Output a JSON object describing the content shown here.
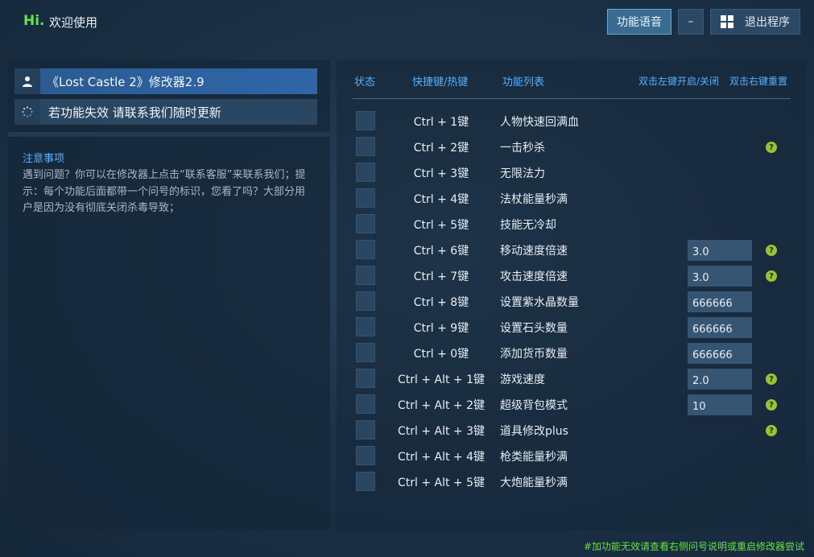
{
  "header": {
    "hi": "Hi.",
    "welcome": "欢迎使用",
    "voice_button": "功能语音",
    "minimize": "–",
    "exit_button": "退出程序"
  },
  "sidebar": {
    "title": "《Lost Castle 2》修改器2.9",
    "update_notice": "若功能失效  请联系我们随时更新",
    "notes_title": "注意事项",
    "notes_body": "遇到问题？你可以在修改器上点击“联系客服”来联系我们；提示：每个功能后面都带一个问号的标识，您看了吗？大部分用户是因为没有彻底关闭杀毒导致；"
  },
  "table": {
    "headers": {
      "status": "状态",
      "hotkey": "快捷键/热键",
      "functions": "功能列表",
      "toggle_hint": "双击左键开启/关闭",
      "reset_hint": "双击右键重置"
    },
    "rows": [
      {
        "hotkey": "Ctrl + 1键",
        "name": "人物快速回满血",
        "value": null,
        "help": false
      },
      {
        "hotkey": "Ctrl + 2键",
        "name": "一击秒杀",
        "value": null,
        "help": true
      },
      {
        "hotkey": "Ctrl + 3键",
        "name": "无限法力",
        "value": null,
        "help": false
      },
      {
        "hotkey": "Ctrl + 4键",
        "name": "法杖能量秒满",
        "value": null,
        "help": false
      },
      {
        "hotkey": "Ctrl + 5键",
        "name": "技能无冷却",
        "value": null,
        "help": false
      },
      {
        "hotkey": "Ctrl + 6键",
        "name": "移动速度倍速",
        "value": "3.0",
        "help": true
      },
      {
        "hotkey": "Ctrl + 7键",
        "name": "攻击速度倍速",
        "value": "3.0",
        "help": true
      },
      {
        "hotkey": "Ctrl + 8键",
        "name": "设置紫水晶数量",
        "value": "666666",
        "help": false
      },
      {
        "hotkey": "Ctrl + 9键",
        "name": "设置石头数量",
        "value": "666666",
        "help": false
      },
      {
        "hotkey": "Ctrl + 0键",
        "name": "添加货币数量",
        "value": "666666",
        "help": false
      },
      {
        "hotkey": "Ctrl + Alt + 1键",
        "name": "游戏速度",
        "value": "2.0",
        "help": true
      },
      {
        "hotkey": "Ctrl + Alt + 2键",
        "name": "超级背包模式",
        "value": "10",
        "help": true
      },
      {
        "hotkey": "Ctrl + Alt + 3键",
        "name": "道具修改plus",
        "value": null,
        "help": true
      },
      {
        "hotkey": "Ctrl + Alt + 4键",
        "name": "枪类能量秒满",
        "value": null,
        "help": false
      },
      {
        "hotkey": "Ctrl + Alt + 5键",
        "name": "大炮能量秒满",
        "value": null,
        "help": false
      }
    ],
    "help_glyph": "?"
  },
  "footer": {
    "note": "#加功能无效请查看右侧问号说明或重启修改器尝试"
  },
  "colors": {
    "accent_blue": "#54b0ff",
    "hi_green": "#5fe64a",
    "help_green": "#9dc230",
    "footer_green": "#69e040"
  },
  "icons": {
    "user": "user-icon",
    "loading": "loading-spinner-icon",
    "windows": "windows-logo-icon",
    "help": "question-mark-icon"
  }
}
